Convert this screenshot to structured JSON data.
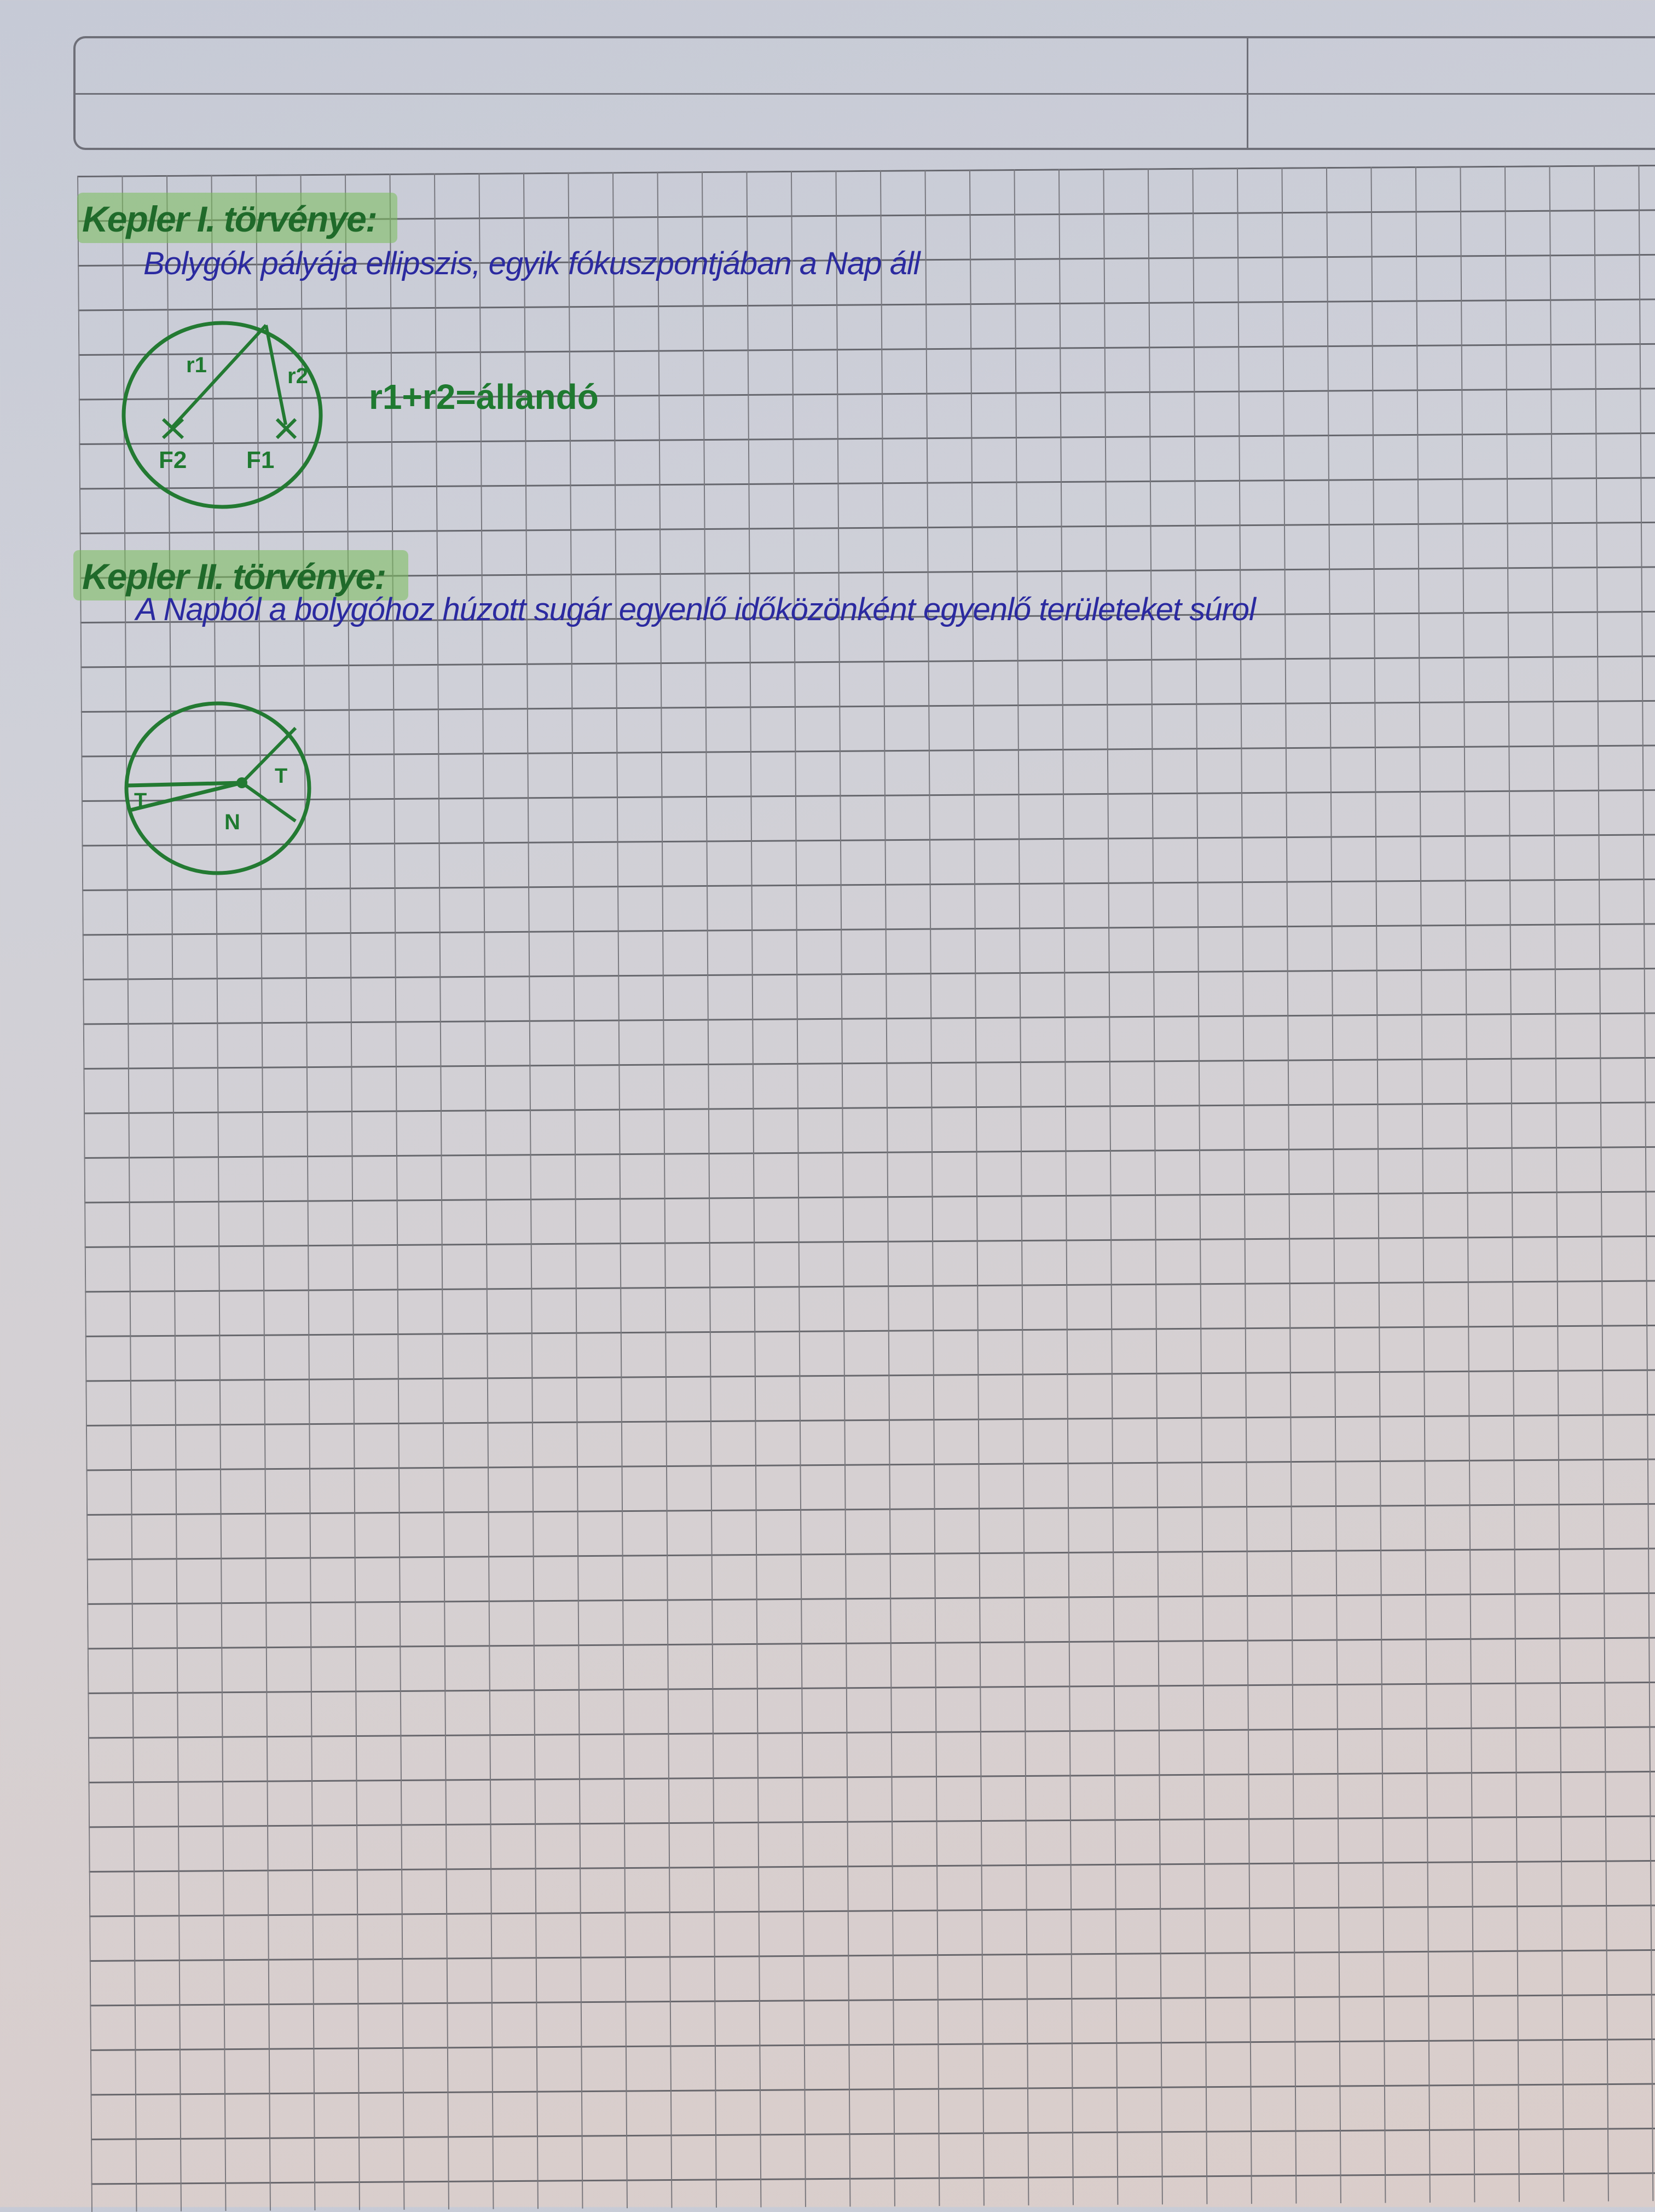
{
  "law1": {
    "heading": "Kepler I. törvénye:",
    "statement": "Bolygók pályája ellipszis, egyik fókuszpontjában a Nap áll",
    "diagram": {
      "r1": "r1",
      "r2": "r2",
      "f1": "F1",
      "f2": "F2"
    },
    "formula": "r1+r2=állandó"
  },
  "law2": {
    "heading": "Kepler II. törvénye:",
    "statement": "A Napból a bolygóhoz húzott sugár egyenlő időközönként egyenlő területeket súrol",
    "diagram": {
      "t_left": "T",
      "t_right": "T",
      "sun": "N"
    }
  },
  "colors": {
    "ink_blue": "#2b2aa0",
    "ink_green": "#1f7a30",
    "highlight": "#78be5a"
  }
}
